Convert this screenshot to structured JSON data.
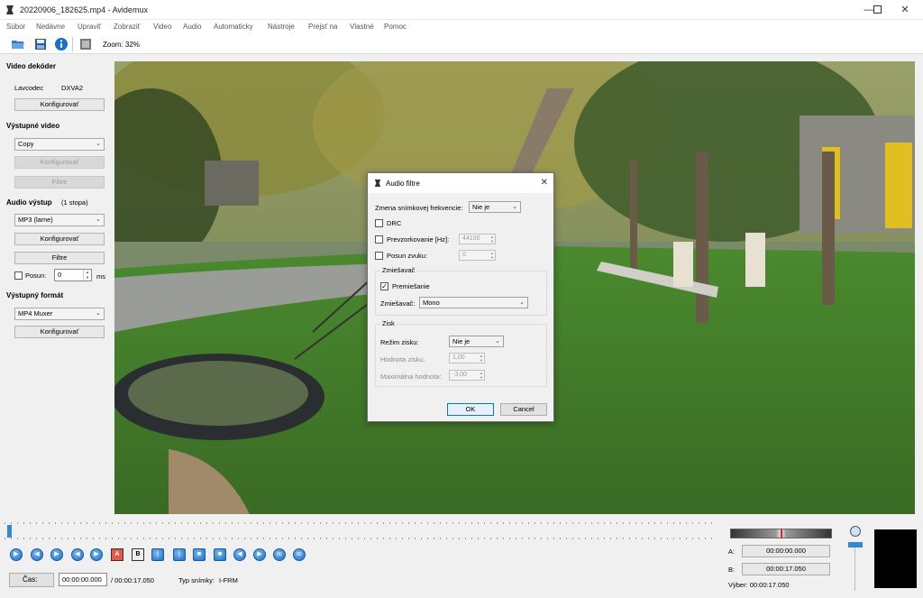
{
  "window": {
    "title": "20220906_182625.mp4 - Avidemux",
    "min_icon": "minimize-icon",
    "max_icon": "maximize-icon",
    "close_icon": "close-icon"
  },
  "menu": [
    "Súbor",
    "Nedávne",
    "Upraviť",
    "Zobraziť",
    "Video",
    "Audio",
    "Automaticky",
    "Nástroje",
    "Prejsť na",
    "Vlastné",
    "Pomoc"
  ],
  "toolbar": {
    "icons": [
      "open-folder-icon",
      "save-icon",
      "info-icon",
      "filmstrip-icon"
    ],
    "zoom": "Zoom: 32%"
  },
  "left_panel": {
    "video_decoder": {
      "heading": "Video dekóder",
      "lav_label": "Lavcodec",
      "lav_value": "DXVA2",
      "configure": "Konfigurovať"
    },
    "output_video": {
      "heading": "Výstupné video",
      "codec": "Copy",
      "configure": "Konfigurovať",
      "filters": "Filtre"
    },
    "audio_output": {
      "heading": "Audio výstup",
      "tracks": "(1 stopa)",
      "codec": "MP3 (lame)",
      "configure": "Konfigurovať",
      "filters": "Filtre",
      "shift_label": "Posun:",
      "shift_value": "0",
      "shift_unit": "ms"
    },
    "output_format": {
      "heading": "Výstupný formát",
      "muxer": "MP4 Muxer",
      "configure": "Konfigurovať"
    }
  },
  "dialog": {
    "title": "Audio filtre",
    "framerate_label": "Zmena snímkovej frekvencie:",
    "framerate_value": "Nie je",
    "drc_label": "DRC",
    "resample_label": "Prevzorkovanie [Hz]:",
    "resample_value": "44100",
    "shift_label": "Posun zvuku:",
    "shift_value": "0",
    "mixer_group": "Zmiešavač",
    "downmix_label": "Premiešanie",
    "downmix_checked": true,
    "mixer_label": "Zmiešavač:",
    "mixer_value": "Mono",
    "gain_group": "Zisk",
    "gain_mode_label": "Režim zisku:",
    "gain_mode_value": "Nie je",
    "gain_value_label": "Hodnota zisku:",
    "gain_value": "1,00",
    "max_value_label": "Maximálna hodnota:",
    "max_value": "-3,00",
    "ok": "OK",
    "cancel": "Cancel"
  },
  "playback": {
    "buttons": [
      "play-icon",
      "rewind-icon",
      "forward-icon",
      "prev-frame-icon",
      "next-frame-icon",
      "marker-a-icon",
      "marker-b-icon",
      "prev-keyframe-icon",
      "next-keyframe-icon",
      "go-marker-a-icon",
      "go-marker-b-icon",
      "prev-black-icon",
      "next-black-icon",
      "back-60-icon",
      "forward-60-icon"
    ],
    "marker_a_glyph": "A",
    "marker_b_glyph": "B",
    "back_60": "60",
    "fwd_60": "60",
    "time_button": "Čas:",
    "current_time": "00:00:00.000",
    "total_time": "/ 00:00:17.050",
    "frame_type_label": "Typ snímky:",
    "frame_type_value": "I-FRM"
  },
  "selection": {
    "a_label": "A:",
    "a_value": "00:00:00.000",
    "b_label": "B:",
    "b_value": "00:00:17.050",
    "selection_text": "Výber: 00:00:17.050"
  }
}
